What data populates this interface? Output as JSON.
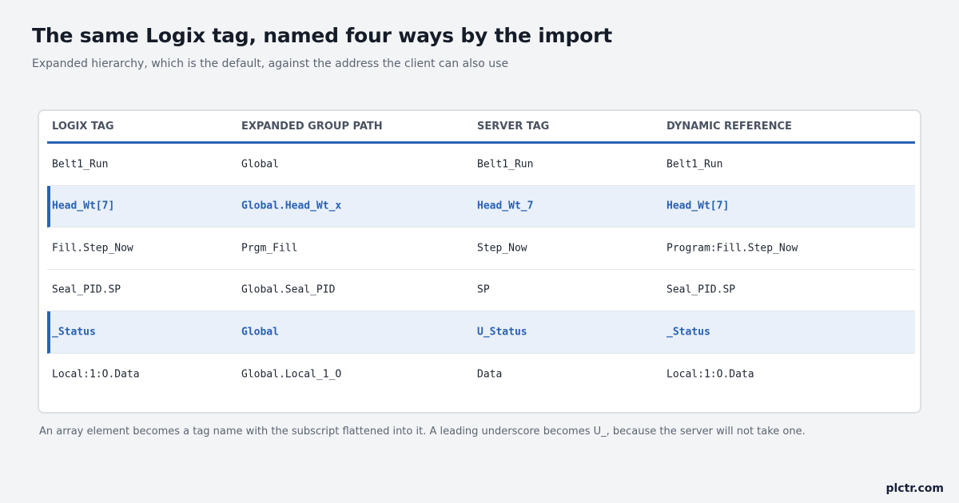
{
  "title": "The same Logix tag, named four ways by the import",
  "subtitle": "Expanded hierarchy, which is the default, against the address the client can also use",
  "table": {
    "headers": [
      "LOGIX TAG",
      "EXPANDED GROUP PATH",
      "SERVER TAG",
      "DYNAMIC REFERENCE"
    ],
    "rows": [
      {
        "highlight": false,
        "cells": [
          "Belt1_Run",
          "Global",
          "Belt1_Run",
          "Belt1_Run"
        ]
      },
      {
        "highlight": true,
        "cells": [
          "Head_Wt[7]",
          "Global.Head_Wt_x",
          "Head_Wt_7",
          "Head_Wt[7]"
        ]
      },
      {
        "highlight": false,
        "cells": [
          "Fill.Step_Now",
          "Prgm_Fill",
          "Step_Now",
          "Program:Fill.Step_Now"
        ]
      },
      {
        "highlight": false,
        "cells": [
          "Seal_PID.SP",
          "Global.Seal_PID",
          "SP",
          "Seal_PID.SP"
        ]
      },
      {
        "highlight": true,
        "cells": [
          "_Status",
          "Global",
          "U_Status",
          "_Status"
        ]
      },
      {
        "highlight": false,
        "cells": [
          "Local:1:O.Data",
          "Global.Local_1_O",
          "Data",
          "Local:1:O.Data"
        ]
      }
    ]
  },
  "footnote": "An array element becomes a tag name with the subscript flattened into it. A leading underscore becomes U_, because the server will not take one.",
  "brand": "plctr.com",
  "colors": {
    "accent": "#2962b3",
    "highlight_background": "#e9f0f9",
    "page_background": "#f3f4f6"
  }
}
